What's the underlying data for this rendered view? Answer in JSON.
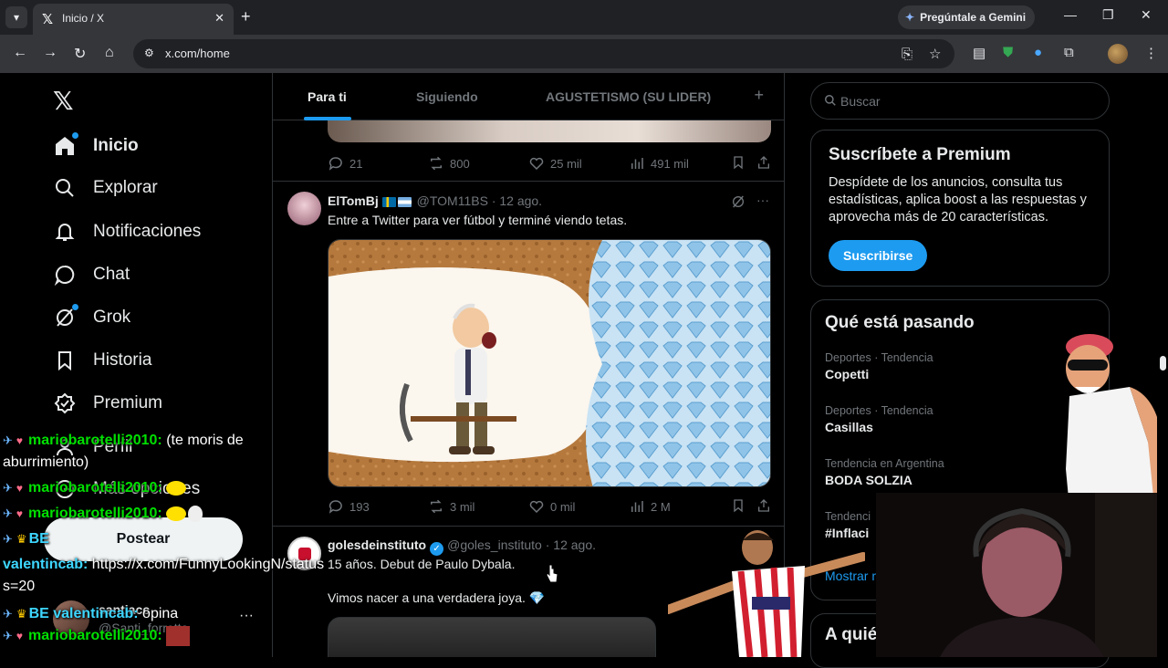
{
  "browser": {
    "tab_title": "Inicio / X",
    "gemini_label": "Pregúntale a Gemini",
    "url": "x.com/home"
  },
  "nav": {
    "items": [
      {
        "label": "Inicio",
        "icon": "home-icon"
      },
      {
        "label": "Explorar",
        "icon": "search-icon"
      },
      {
        "label": "Notificaciones",
        "icon": "bell-icon"
      },
      {
        "label": "Chat",
        "icon": "chat-icon"
      },
      {
        "label": "Grok",
        "icon": "grok-icon"
      },
      {
        "label": "Historia",
        "icon": "bookmark-icon"
      },
      {
        "label": "Premium",
        "icon": "verified-icon"
      },
      {
        "label": "Perfil",
        "icon": "profile-icon"
      },
      {
        "label": "Más opciones",
        "icon": "more-icon"
      }
    ],
    "post_label": "Postear",
    "account": {
      "name": "santiacc",
      "handle": "@Santi_forretta"
    }
  },
  "timeline": {
    "tabs": [
      "Para ti",
      "Siguiendo",
      "AGUSTETISMO (SU LIDER)"
    ],
    "tweet0_actions": {
      "replies": "21",
      "reposts": "800",
      "likes": "25 mil",
      "views": "491 mil"
    },
    "tweet1": {
      "name": "ElTomBj",
      "handle": "@TOM11BS",
      "date": "· 12 ago.",
      "text": "Entre a Twitter para ver fútbol y terminé viendo tetas.",
      "actions": {
        "replies": "193",
        "reposts": "3 mil",
        "likes": "0 mil",
        "views": "2 M"
      }
    },
    "tweet2": {
      "name": "golesdeinstituto",
      "handle": "@goles_instituto",
      "date": "· 12 ago.",
      "text1": "15 años. Debut de Paulo Dybala.",
      "text2": "Vimos nacer a una verdadera joya. 💎"
    }
  },
  "sidebar": {
    "search_placeholder": "Buscar",
    "premium": {
      "title": "Suscríbete a Premium",
      "desc": "Despídete de los anuncios, consulta tus estadísticas, aplica boost a las respuestas y aprovecha más de 20 características.",
      "button": "Suscribirse"
    },
    "trends": {
      "title": "Qué está pasando",
      "items": [
        {
          "context": "Deportes · Tendencia",
          "name": "Copetti"
        },
        {
          "context": "Deportes · Tendencia",
          "name": "Casillas"
        },
        {
          "context": "Tendencia en Argentina",
          "name": "BODA SOLZIA"
        },
        {
          "context": "Tendenci",
          "name": "#Inflaci"
        }
      ],
      "show_more": "Mostrar m"
    },
    "who_title": "A quié"
  },
  "chat": {
    "lines": [
      {
        "user": "mariobarotelli2010:",
        "msg": " (te moris de"
      },
      {
        "user": "",
        "msg": "aburrimiento)"
      },
      {
        "user": "mariobarotelli2010:",
        "msg": ""
      },
      {
        "user": "mariobarotelli2010:",
        "msg": ""
      },
      {
        "user": "valentincab:",
        "msg": " https://x.com/FunnyLookingN/status"
      },
      {
        "user": "",
        "msg": "s=20"
      },
      {
        "user": "valentincab:",
        "msg": " opina"
      },
      {
        "user": "mariobarotelli2010:",
        "msg": ""
      }
    ],
    "badge_short": "BE"
  },
  "colors": {
    "accent": "#1d9bf0",
    "bg": "#000000",
    "border": "#2f3336",
    "muted": "#71767b"
  }
}
